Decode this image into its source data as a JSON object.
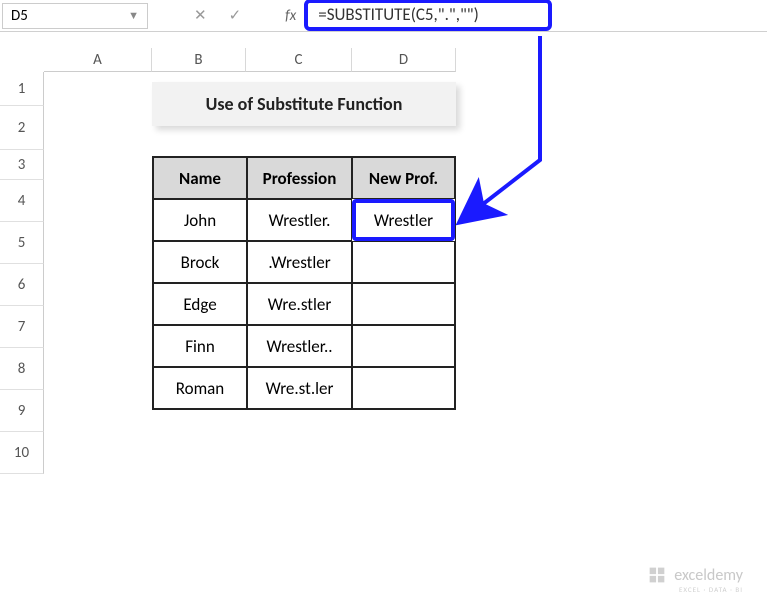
{
  "nameBox": "D5",
  "formula": "=SUBSTITUTE(C5,\".\",\"\")",
  "columns": [
    "A",
    "B",
    "C",
    "D"
  ],
  "rowNumbers": [
    "1",
    "2",
    "3",
    "4",
    "5",
    "6",
    "7",
    "8",
    "9",
    "10"
  ],
  "title": "Use of Substitute Function",
  "table": {
    "headers": [
      "Name",
      "Profession",
      "New Prof."
    ],
    "rows": [
      {
        "name": "John",
        "prof": "Wrestler.",
        "newp": "Wrestler"
      },
      {
        "name": "Brock",
        "prof": ".Wrestler",
        "newp": ""
      },
      {
        "name": "Edge",
        "prof": "Wre.stler",
        "newp": ""
      },
      {
        "name": "Finn",
        "prof": "Wrestler..",
        "newp": ""
      },
      {
        "name": "Roman",
        "prof": "Wre.st.ler",
        "newp": ""
      }
    ]
  },
  "watermark": {
    "brand": "exceldemy",
    "tagline": "EXCEL · DATA · BI"
  }
}
